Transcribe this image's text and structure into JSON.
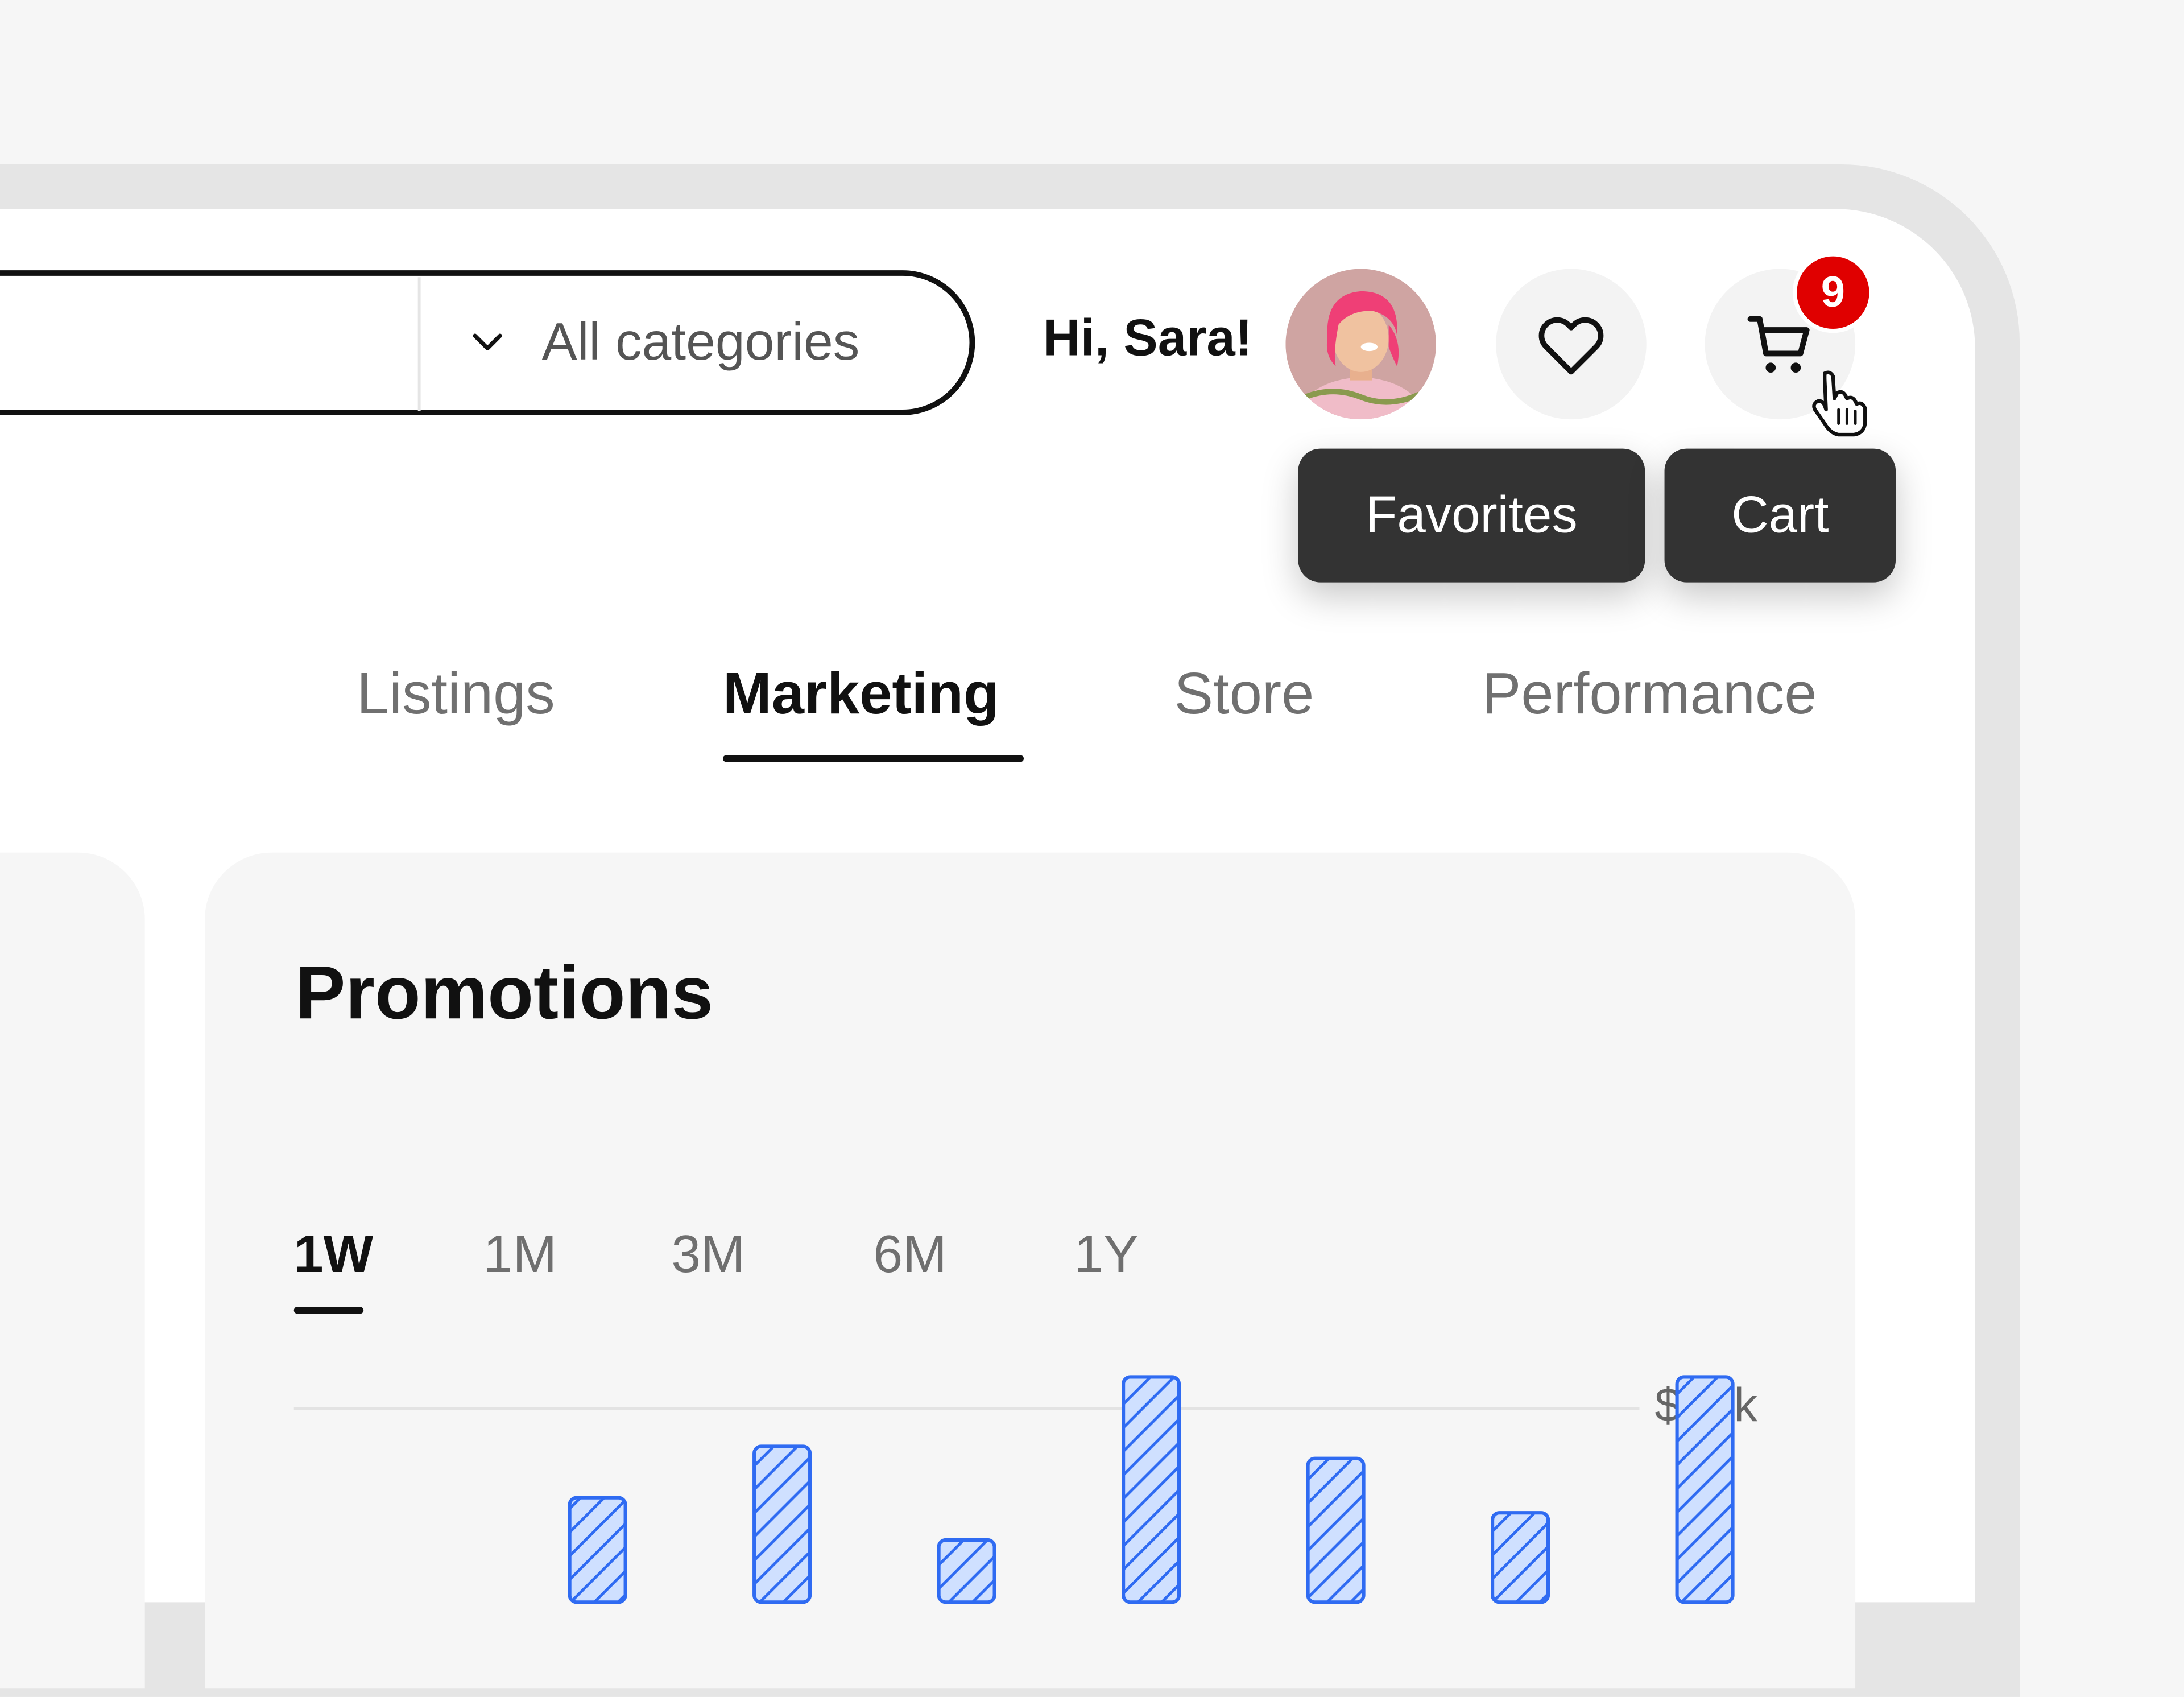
{
  "search": {
    "category_label": "All categories"
  },
  "header": {
    "greeting": "Hi, Sara!",
    "cart_count": "9"
  },
  "tooltips": {
    "favorites": "Favorites",
    "cart": "Cart"
  },
  "nav": {
    "tabs": [
      {
        "label": "Listings",
        "active": false
      },
      {
        "label": "Marketing",
        "active": true
      },
      {
        "label": "Store",
        "active": false
      },
      {
        "label": "Performance",
        "active": false
      }
    ]
  },
  "promotions": {
    "title": "Promotions",
    "ranges": [
      "1W",
      "1M",
      "3M",
      "6M",
      "1Y"
    ],
    "active_range": "1W"
  },
  "chart_data": {
    "type": "bar",
    "title": "Promotions",
    "y_tick_labels": [
      "$60k"
    ],
    "values": [
      30000,
      47000,
      16000,
      70000,
      43000,
      25000,
      70000
    ],
    "bar_color": "#2f6bf2",
    "bar_fill": "#cfe0ff",
    "grid": true
  },
  "colors": {
    "badge": "#e00000",
    "tooltip_bg": "#333333",
    "accent_bar": "#2f6bf2"
  }
}
